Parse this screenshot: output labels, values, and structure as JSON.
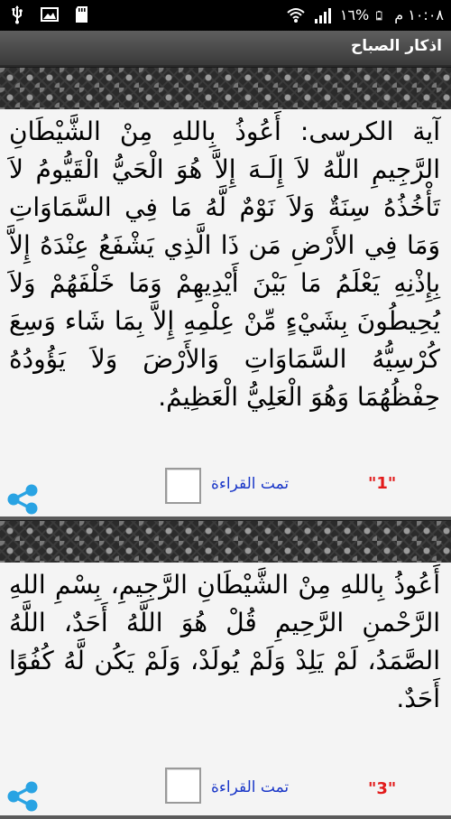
{
  "status_bar": {
    "time": "١٠:٠٨ م",
    "battery": "١٦%",
    "icons": [
      "usb-icon",
      "image-icon",
      "sd-card-icon",
      "wifi-icon",
      "signal-icon",
      "battery-icon"
    ]
  },
  "header": {
    "title": "اذكار الصباح"
  },
  "cards": [
    {
      "text": "آية الكرسى: أَعُوذُ بِاللهِ مِنْ الشَّيْطَانِ الرَّجِيمِ اللّهُ لاَ إِلَـهَ إِلاَّ هُوَ الْحَيُّ الْقَيُّومُ لاَ تَأْخُذُهُ سِنَةٌ وَلاَ نَوْمٌ لَّهُ مَا فِي السَّمَاوَاتِ وَمَا فِي الأَرْضِ مَن ذَا الَّذِي يَشْفَعُ عِنْدَهُ إِلاَّ بِإِذْنِهِ يَعْلَمُ مَا بَيْنَ أَيْدِيهِمْ وَمَا خَلْفَهُمْ وَلاَ يُحِيطُونَ بِشَيْءٍ مِّنْ عِلْمِهِ إِلاَّ بِمَا شَاء وَسِعَ كُرْسِيُّهُ السَّمَاوَاتِ وَالأَرْضَ وَلاَ يَؤُودُهُ حِفْظُهُمَا وَهُوَ الْعَلِيُّ الْعَظِيمُ.",
      "read_label": "تمت القراءة",
      "count": "\"1\""
    },
    {
      "text": "أَعُوذُ بِاللهِ مِنْ الشَّيْطَانِ الرَّجِيمِ، بِسْمِ اللهِ الرَّحْمنِ الرَّحِيمِ قُلْ هُوَ اللَّهُ أَحَدٌ، اللَّهُ الصَّمَدُ، لَمْ يَلِدْ وَلَمْ يُولَدْ، وَلَمْ يَكُن لَّهُ كُفُوًا أَحَدٌ.",
      "read_label": "تمت القراءة",
      "count": "\"3\""
    }
  ],
  "colors": {
    "read_label": "#1a37c8",
    "count": "#e21b1b",
    "share": "#29a3e3",
    "title_bar": "#4a4a4a"
  }
}
